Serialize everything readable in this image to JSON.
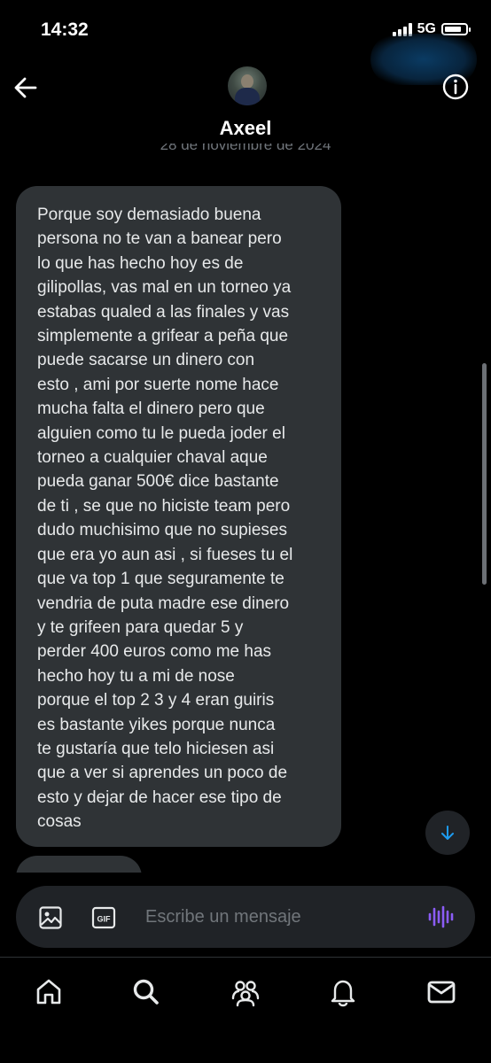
{
  "status_bar": {
    "time": "14:32",
    "network": "5G",
    "signal_bars": 4,
    "battery_level": 0.8
  },
  "header": {
    "contact_name": "Axeel",
    "back_icon": "arrow-left-icon",
    "info_icon": "info-icon",
    "date_separator": "28 de noviembre de 2024"
  },
  "messages": [
    {
      "direction": "incoming",
      "text": "Porque soy demasiado buena\npersona no te van a banear pero\nlo que has hecho hoy es de\ngilipollas, vas mal en un torneo ya\nestabas qualed a las finales y vas\nsimplemente a grifear a peña que\npuede sacarse un dinero con\nesto , ami por suerte nome hace\nmucha falta el dinero pero que\nalguien como tu le pueda joder el\ntorneo a cualquier chaval aque\npueda ganar 500€ dice bastante\nde ti , se que no hiciste team pero\ndudo muchisimo que no supieses\nque era yo aun asi , si fueses tu el\nque va top 1 que seguramente te\nvendria de puta madre ese dinero\ny te grifeen para quedar 5 y\nperder 400 euros como me has\nhecho hoy tu a mi de nose\nporque el top 2 3 y 4 eran guiris\nes bastante yikes porque nunca\nte gustaría que telo hiciesen asi\nque a ver si aprendes un poco de\nesto y dejar de hacer ese tipo de\ncosas"
    }
  ],
  "composer": {
    "placeholder": "Escribe un mensaje",
    "gif_label": "GIF"
  },
  "colors": {
    "background": "#000000",
    "bubble": "#2f3336",
    "accent": "#1d9bf0",
    "voice_accent": "#8b5cf6"
  },
  "tabbar": {
    "tabs": [
      "home-icon",
      "search-icon",
      "communities-icon",
      "bell-icon",
      "mail-icon"
    ]
  }
}
